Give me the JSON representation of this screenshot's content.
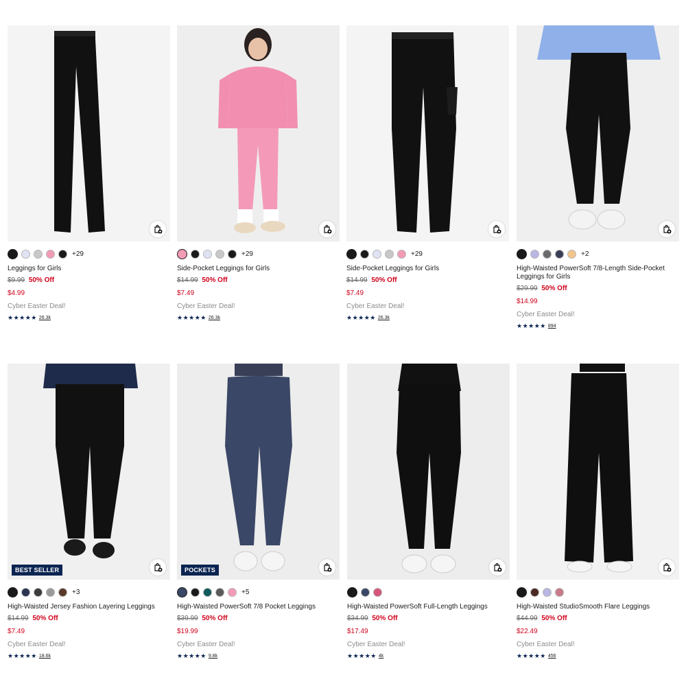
{
  "products": [
    {
      "title": "Leggings for Girls",
      "original_price": "$9.99",
      "discount": "50% Off",
      "sale_price": "$4.99",
      "promo": "Cyber Easter Deal!",
      "stars": "★★★★★",
      "reviews": "26.3k",
      "more_colors": "+29",
      "badge": null,
      "swatches": [
        "#1a1a1a",
        "#dfe3f3",
        "#c8c8c8",
        "#f29bb5",
        "#1a1a1a"
      ],
      "photo": "flat-black-leggings"
    },
    {
      "title": "Side-Pocket Leggings for Girls",
      "original_price": "$14.99",
      "discount": "50% Off",
      "sale_price": "$7.49",
      "promo": "Cyber Easter Deal!",
      "stars": "★★★★★",
      "reviews": "26.3k",
      "more_colors": "+29",
      "badge": null,
      "swatches": [
        "#f29bb5",
        "#1a1a1a",
        "#dfe3f3",
        "#c8c8c8",
        "#1a1a1a"
      ],
      "photo": "girl-pink-outfit"
    },
    {
      "title": "Side-Pocket Leggings for Girls",
      "original_price": "$14.99",
      "discount": "50% Off",
      "sale_price": "$7.49",
      "promo": "Cyber Easter Deal!",
      "stars": "★★★★★",
      "reviews": "26.3k",
      "more_colors": "+29",
      "badge": null,
      "swatches": [
        "#1a1a1a",
        "#1a1a1a",
        "#dfe3f3",
        "#c8c8c8",
        "#f29bb5"
      ],
      "photo": "flat-black-pocket-leggings"
    },
    {
      "title": "High-Waisted PowerSoft 7/8-Length Side-Pocket Leggings for Girls",
      "original_price": "$29.99",
      "discount": "50% Off",
      "sale_price": "$14.99",
      "promo": "Cyber Easter Deal!",
      "stars": "★★★★★",
      "reviews": "894",
      "more_colors": "+2",
      "badge": null,
      "swatches": [
        "#1a1a1a",
        "#b9b6e3",
        "#6b6b6b",
        "#3a3f58",
        "#f1c68c"
      ],
      "photo": "girl-black-leggings-blue-jacket"
    },
    {
      "title": "High-Waisted Jersey Fashion Layering Leggings",
      "original_price": "$14.99",
      "discount": "50% Off",
      "sale_price": "$7.49",
      "promo": "Cyber Easter Deal!",
      "stars": "★★★★★",
      "reviews": "18.6k",
      "more_colors": "+3",
      "badge": "BEST SELLER",
      "swatches": [
        "#1a1a1a",
        "#2b3450",
        "#3b3b3b",
        "#9a9a9a",
        "#5a3a2a"
      ],
      "photo": "woman-black-leggings-loafers"
    },
    {
      "title": "High-Waisted PowerSoft 7/8 Pocket Leggings",
      "original_price": "$39.99",
      "discount": "50% Off",
      "sale_price": "$19.99",
      "promo": "Cyber Easter Deal!",
      "stars": "★★★★★",
      "reviews": "9.8k",
      "more_colors": "+5",
      "badge": "POCKETS",
      "swatches": [
        "#3a4766",
        "#1a1a1a",
        "#0f5a5a",
        "#5a5a5a",
        "#f29bb5"
      ],
      "photo": "woman-navy-leggings"
    },
    {
      "title": "High-Waisted PowerSoft Full-Length Leggings",
      "original_price": "$34.99",
      "discount": "50% Off",
      "sale_price": "$17.49",
      "promo": "Cyber Easter Deal!",
      "stars": "★★★★★",
      "reviews": "4k",
      "more_colors": "",
      "badge": null,
      "swatches": [
        "#1a1a1a",
        "#3a4766",
        "#d4567a"
      ],
      "photo": "woman-black-powersoft-leggings"
    },
    {
      "title": "High-Waisted StudioSmooth Flare Leggings",
      "original_price": "$44.99",
      "discount": "50% Off",
      "sale_price": "$22.49",
      "promo": "Cyber Easter Deal!",
      "stars": "★★★★★",
      "reviews": "456",
      "more_colors": "",
      "badge": null,
      "swatches": [
        "#1a1a1a",
        "#4a2a22",
        "#b9b6e3",
        "#c87a8a"
      ],
      "photo": "woman-black-flare-leggings"
    }
  ],
  "icons": {
    "add_to_bag": "shopping-bag-plus-icon",
    "star": "star-icon"
  },
  "colors": {
    "sale_red": "#d0021b",
    "navy": "#0b2451"
  }
}
